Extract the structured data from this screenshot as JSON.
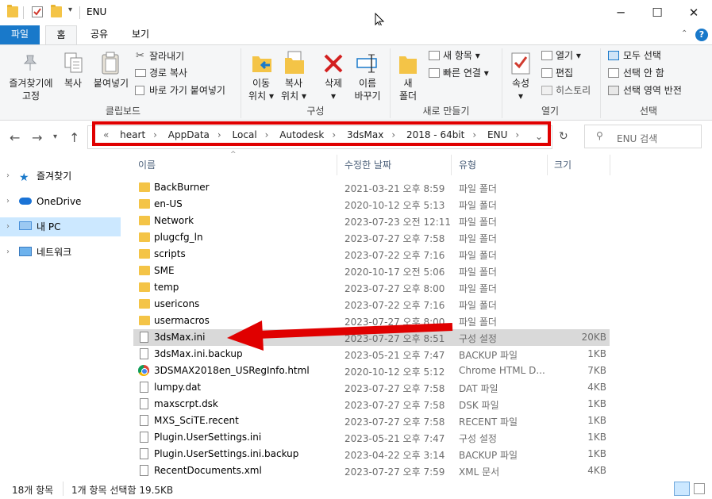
{
  "window": {
    "title": "ENU",
    "minimize_glyph": "─",
    "maximize_glyph": "☐",
    "close_glyph": "✕"
  },
  "ribbon_tabs": [
    {
      "label": "파일"
    },
    {
      "label": "홈"
    },
    {
      "label": "공유"
    },
    {
      "label": "보기"
    }
  ],
  "ribbon": {
    "clipboard": {
      "pin_label_1": "즐겨찾기에",
      "pin_label_2": "고정",
      "copy_label": "복사",
      "paste_label": "붙여넣기",
      "cut_label": "잘라내기",
      "copy_path_label": "경로 복사",
      "paste_shortcut_label": "바로 가기 붙여넣기",
      "group_label": "클립보드"
    },
    "organize": {
      "move_label_1": "이동",
      "move_label_2": "위치",
      "copyto_label_1": "복사",
      "copyto_label_2": "위치",
      "delete_label": "삭제",
      "rename_label_1": "이름",
      "rename_label_2": "바꾸기",
      "group_label": "구성"
    },
    "new": {
      "new_folder_label_1": "새",
      "new_folder_label_2": "폴더",
      "new_item_label": "새 항목",
      "easy_access_label": "빠른 연결",
      "group_label": "새로 만들기"
    },
    "open": {
      "properties_label": "속성",
      "open_label": "열기",
      "edit_label": "편집",
      "history_label": "히스토리",
      "group_label": "열기"
    },
    "select": {
      "select_all_label": "모두 선택",
      "select_none_label": "선택 안 함",
      "invert_label": "선택 영역 반전",
      "group_label": "선택"
    }
  },
  "address": {
    "overflow": "«",
    "crumbs": [
      "heart",
      "AppData",
      "Local",
      "Autodesk",
      "3dsMax",
      "2018 - 64bit",
      "ENU"
    ],
    "search_placeholder": "ENU 검색"
  },
  "nav_pane": {
    "items": [
      {
        "label": "즐겨찾기"
      },
      {
        "label": "OneDrive"
      },
      {
        "label": "내 PC"
      },
      {
        "label": "네트워크"
      }
    ]
  },
  "columns": {
    "name": "이름",
    "date": "수정한 날짜",
    "type": "유형",
    "size": "크기"
  },
  "files": [
    {
      "name": "BackBurner",
      "date": "2021-03-21 오후 8:59",
      "type": "파일 폴더",
      "size": "",
      "kind": "folder"
    },
    {
      "name": "en-US",
      "date": "2020-10-12 오후 5:13",
      "type": "파일 폴더",
      "size": "",
      "kind": "folder"
    },
    {
      "name": "Network",
      "date": "2023-07-23 오전 12:11",
      "type": "파일 폴더",
      "size": "",
      "kind": "folder"
    },
    {
      "name": "plugcfg_ln",
      "date": "2023-07-27 오후 7:58",
      "type": "파일 폴더",
      "size": "",
      "kind": "folder"
    },
    {
      "name": "scripts",
      "date": "2023-07-22 오후 7:16",
      "type": "파일 폴더",
      "size": "",
      "kind": "folder"
    },
    {
      "name": "SME",
      "date": "2020-10-17 오전 5:06",
      "type": "파일 폴더",
      "size": "",
      "kind": "folder"
    },
    {
      "name": "temp",
      "date": "2023-07-27 오후 8:00",
      "type": "파일 폴더",
      "size": "",
      "kind": "folder"
    },
    {
      "name": "usericons",
      "date": "2023-07-22 오후 7:16",
      "type": "파일 폴더",
      "size": "",
      "kind": "folder"
    },
    {
      "name": "usermacros",
      "date": "2023-07-27 오후 8:00",
      "type": "파일 폴더",
      "size": "",
      "kind": "folder"
    },
    {
      "name": "3dsMax.ini",
      "date": "2023-07-27 오후 8:51",
      "type": "구성 설정",
      "size": "20KB",
      "kind": "doc",
      "selected": true
    },
    {
      "name": "3dsMax.ini.backup",
      "date": "2023-05-21 오후 7:47",
      "type": "BACKUP 파일",
      "size": "1KB",
      "kind": "doc"
    },
    {
      "name": "3DSMAX2018en_USRegInfo.html",
      "date": "2020-10-12 오후 5:12",
      "type": "Chrome HTML D...",
      "size": "7KB",
      "kind": "chrome"
    },
    {
      "name": "lumpy.dat",
      "date": "2023-07-27 오후 7:58",
      "type": "DAT 파일",
      "size": "4KB",
      "kind": "doc"
    },
    {
      "name": "maxscrpt.dsk",
      "date": "2023-07-27 오후 7:58",
      "type": "DSK 파일",
      "size": "1KB",
      "kind": "doc"
    },
    {
      "name": "MXS_SciTE.recent",
      "date": "2023-07-27 오후 7:58",
      "type": "RECENT 파일",
      "size": "1KB",
      "kind": "doc"
    },
    {
      "name": "Plugin.UserSettings.ini",
      "date": "2023-05-21 오후 7:47",
      "type": "구성 설정",
      "size": "1KB",
      "kind": "doc"
    },
    {
      "name": "Plugin.UserSettings.ini.backup",
      "date": "2023-04-22 오후 3:14",
      "type": "BACKUP 파일",
      "size": "1KB",
      "kind": "doc"
    },
    {
      "name": "RecentDocuments.xml",
      "date": "2023-07-27 오후 7:59",
      "type": "XML 문서",
      "size": "4KB",
      "kind": "doc"
    }
  ],
  "status": {
    "count": "18개 항목",
    "selection": "1개 항목 선택함 19.5KB"
  },
  "colors": {
    "accent": "#1979ca",
    "highlight": "#e00000",
    "folder": "#f4c447",
    "selected_row": "#d9d9d9"
  }
}
